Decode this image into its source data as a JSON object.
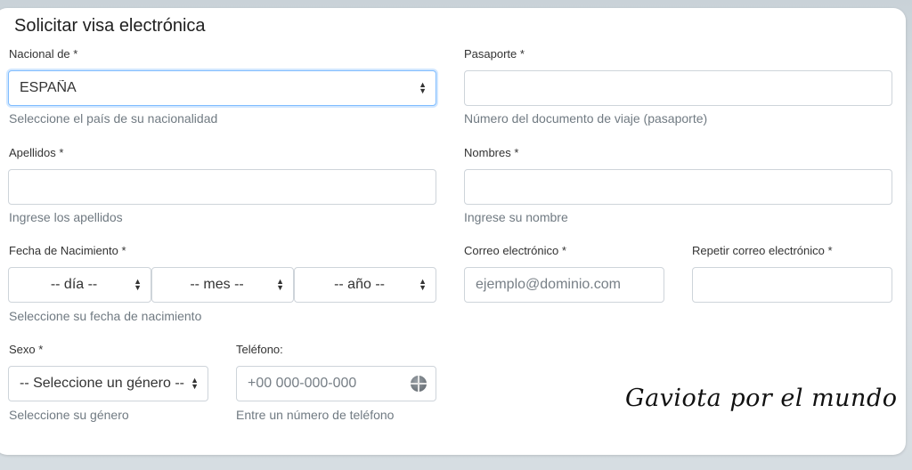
{
  "form": {
    "title": "Solicitar visa electrónica",
    "nationality": {
      "label": "Nacional de *",
      "value": "ESPAÑA",
      "help": "Seleccione el país de su nacionalidad"
    },
    "passport": {
      "label": "Pasaporte *",
      "value": "",
      "help": "Número del documento de viaje (pasaporte)"
    },
    "surnames": {
      "label": "Apellidos *",
      "value": "",
      "help": "Ingrese los apellidos"
    },
    "names": {
      "label": "Nombres *",
      "value": "",
      "help": "Ingrese su nombre"
    },
    "birthdate": {
      "label": "Fecha de Nacimiento *",
      "day": "-- día --",
      "month": "-- mes --",
      "year": "-- año --",
      "help": "Seleccione su fecha de nacimiento"
    },
    "email": {
      "label": "Correo electrónico *",
      "placeholder": "ejemplo@dominio.com"
    },
    "email_repeat": {
      "label": "Repetir correo electrónico *",
      "value": ""
    },
    "sex": {
      "label": "Sexo *",
      "value": "-- Seleccione un género --",
      "help": "Seleccione su género"
    },
    "phone": {
      "label": "Teléfono:",
      "placeholder": "+00 000-000-000",
      "help": "Entre un número de teléfono",
      "icon": "globe-icon"
    }
  },
  "watermark": {
    "text": "Gaviota por el mundo"
  }
}
